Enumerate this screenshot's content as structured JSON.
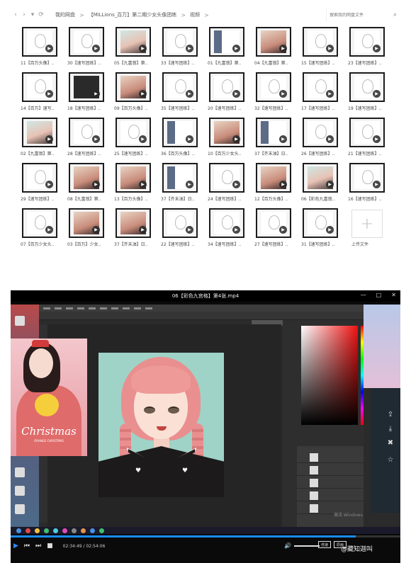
{
  "drive": {
    "nav": {
      "back": "‹",
      "forward": "›",
      "dropdown": "▾",
      "refresh": "⟳"
    },
    "breadcrumbs": [
      "我的网盘",
      "【MiLLions_百万】第二期少女头像团练",
      "视频"
    ],
    "search_placeholder": "搜索我的网盘文件",
    "files": [
      {
        "name": "11【百万头像】..",
        "style": "light"
      },
      {
        "name": "30【速写团练】..",
        "style": "light"
      },
      {
        "name": "05【九富翁】第..",
        "style": "teal"
      },
      {
        "name": "33【速写团练】..",
        "style": "light"
      },
      {
        "name": "01【九富翁】第..",
        "style": "mixed"
      },
      {
        "name": "04【九富翁】第..",
        "style": "warm"
      },
      {
        "name": "15【速写团练】..",
        "style": "light"
      },
      {
        "name": "23【速写团练】..",
        "style": "light"
      },
      {
        "name": "14【百万】速写..",
        "style": "light"
      },
      {
        "name": "18【速写团练】..",
        "style": "dark"
      },
      {
        "name": "09【百万头像】..",
        "style": "warm"
      },
      {
        "name": "35【速写团练】..",
        "style": "light"
      },
      {
        "name": "20【速写团练】..",
        "style": "light"
      },
      {
        "name": "32【速写团练】..",
        "style": "light"
      },
      {
        "name": "17【速写团练】..",
        "style": "light"
      },
      {
        "name": "19【速写团练】..",
        "style": "light"
      },
      {
        "name": "02【九富翁】第..",
        "style": "teal"
      },
      {
        "name": "28【速写团练】..",
        "style": "light"
      },
      {
        "name": "25【速写团练】..",
        "style": "light"
      },
      {
        "name": "36【百万头像】..",
        "style": "mixed"
      },
      {
        "name": "10【百万少女头..",
        "style": "warm"
      },
      {
        "name": "37【齐末油】日..",
        "style": "mixed"
      },
      {
        "name": "26【速写团练】..",
        "style": "light"
      },
      {
        "name": "21【速写团练】..",
        "style": "light"
      },
      {
        "name": "29【速写团练】..",
        "style": "light"
      },
      {
        "name": "08【九富翁】第..",
        "style": "warm"
      },
      {
        "name": "13【百万头像】..",
        "style": "warm"
      },
      {
        "name": "37【齐末油】日..",
        "style": "mixed"
      },
      {
        "name": "24【速写团练】..",
        "style": "light"
      },
      {
        "name": "12【百万头像】..",
        "style": "warm"
      },
      {
        "name": "06【彩色九富翁..",
        "style": "teal"
      },
      {
        "name": "16【速写团练】..",
        "style": "light"
      },
      {
        "name": "07【百万少女头..",
        "style": "light"
      },
      {
        "name": "03【百万】少女..",
        "style": "warm"
      },
      {
        "name": "37【齐末油】日..",
        "style": "warm"
      },
      {
        "name": "22【速写团练】..",
        "style": "light"
      },
      {
        "name": "34【速写团练】..",
        "style": "light"
      },
      {
        "name": "27【速写团练】..",
        "style": "light"
      },
      {
        "name": "31【速写团练】..",
        "style": "light"
      }
    ],
    "upload_label": "上传文件",
    "upload_glyph": "+"
  },
  "player": {
    "title": "06【彩色九宫格】第4张.mp4",
    "window_controls": [
      "—",
      "□",
      "✕"
    ],
    "reference_text": "Christmas",
    "reference_subtext": "ORANGE CHRISTMAS",
    "windows_watermark": "激活 Windows",
    "time_current": "02:34:49",
    "time_total": "02:54:06",
    "progress": 0.886,
    "buttons": {
      "play": "▶",
      "prev": "⏮",
      "next": "⏭",
      "stop": "■",
      "volume": "🔊"
    },
    "speed_badge": "倍速",
    "quality_badge": "原画",
    "logo_text": "@藏知迦叫"
  }
}
